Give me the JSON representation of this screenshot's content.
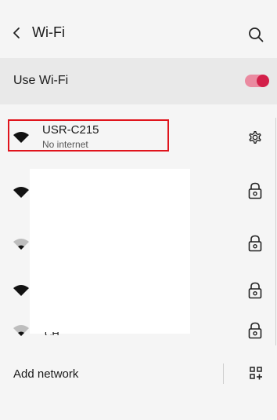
{
  "header": {
    "title": "Wi-Fi",
    "back_icon": "chevron-left-icon",
    "search_icon": "search-icon"
  },
  "wifi_toggle": {
    "label": "Use Wi-Fi",
    "enabled": true,
    "accent_color": "#d3204a"
  },
  "networks": [
    {
      "name": "USR-C215",
      "status": "No internet",
      "signal": "full",
      "right_icon": "gear-icon",
      "highlighted": true
    },
    {
      "name": "",
      "status": "",
      "signal": "full",
      "right_icon": "lock-icon"
    },
    {
      "name": "",
      "status": "",
      "signal": "weak",
      "right_icon": "lock-icon"
    },
    {
      "name": "",
      "status": "",
      "signal": "full",
      "right_icon": "lock-icon"
    },
    {
      "name": "CH...",
      "status": "",
      "signal": "weak",
      "right_icon": "lock-icon"
    }
  ],
  "add_network": {
    "label": "Add network",
    "icon": "qr-code-icon"
  }
}
